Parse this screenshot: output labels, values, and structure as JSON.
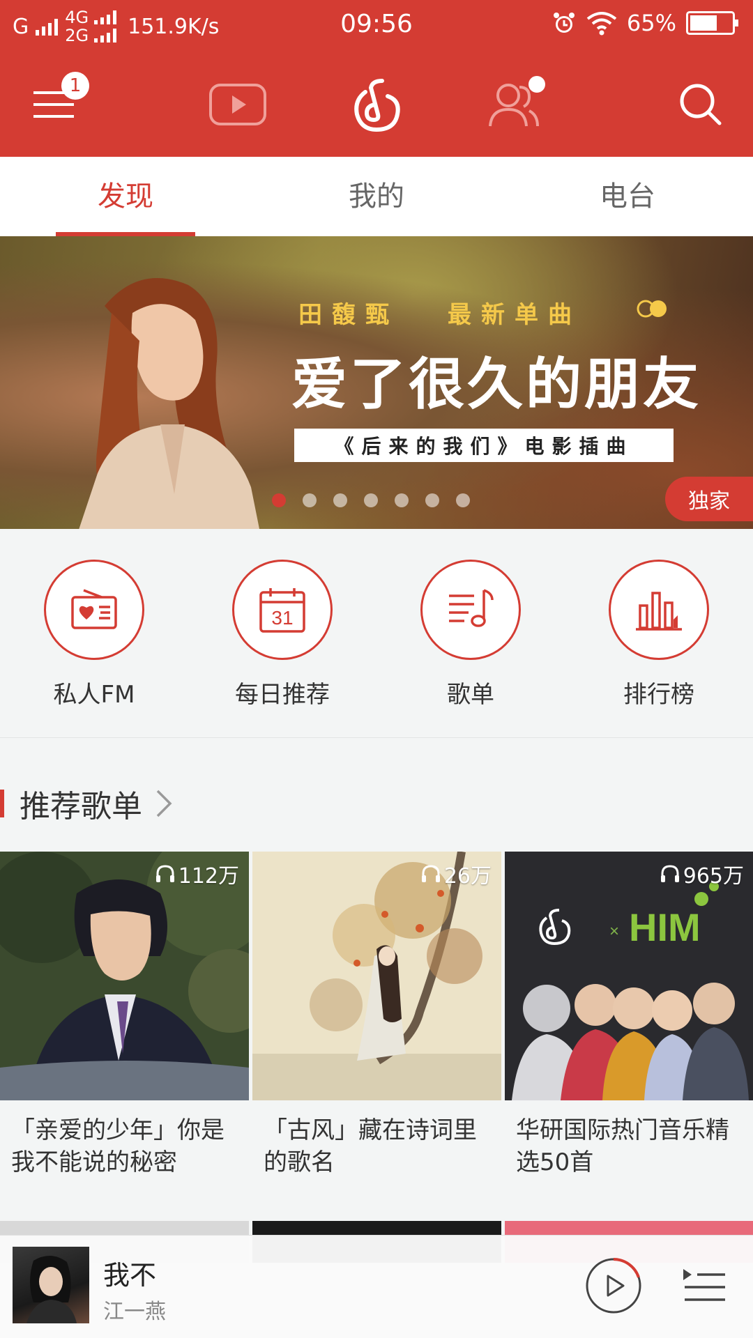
{
  "status_bar": {
    "carrier_left": "G",
    "net_top": "4G",
    "net_bottom": "2G",
    "speed": "151.9K/s",
    "time": "09:56",
    "battery": "65%",
    "battery_level": 0.65
  },
  "top_nav": {
    "menu_badge": "1",
    "icons": [
      "menu-icon",
      "video-icon",
      "netease-music-icon",
      "friends-icon",
      "search-icon"
    ]
  },
  "tabs": [
    {
      "label": "发现",
      "active": true
    },
    {
      "label": "我的",
      "active": false
    },
    {
      "label": "电台",
      "active": false
    }
  ],
  "banner": {
    "artist": "田馥甄",
    "tag": "最新单曲",
    "title": "爱了很久的朋友",
    "subtitle": "《后来的我们》电影插曲",
    "badge": "独家",
    "dots_total": 7,
    "dots_active": 1
  },
  "quick_links": [
    {
      "label": "私人FM",
      "icon": "radio-icon"
    },
    {
      "label": "每日推荐",
      "icon": "calendar-icon",
      "day": "31"
    },
    {
      "label": "歌单",
      "icon": "playlist-icon"
    },
    {
      "label": "排行榜",
      "icon": "chart-icon"
    }
  ],
  "section": {
    "title": "推荐歌单"
  },
  "playlists": [
    {
      "plays": "112万",
      "title": "「亲爱的少年」你是我不能说的秘密"
    },
    {
      "plays": "26万",
      "title": "「古风」藏在诗词里的歌名"
    },
    {
      "plays": "965万",
      "title": "华研国际热门音乐精选50首"
    }
  ],
  "cover_text": {
    "him": "HIM",
    "x": "×"
  },
  "colors": {
    "accent": "#d43c33",
    "background": "#f3f5f5"
  },
  "player": {
    "song": "我不",
    "artist": "江一燕"
  }
}
